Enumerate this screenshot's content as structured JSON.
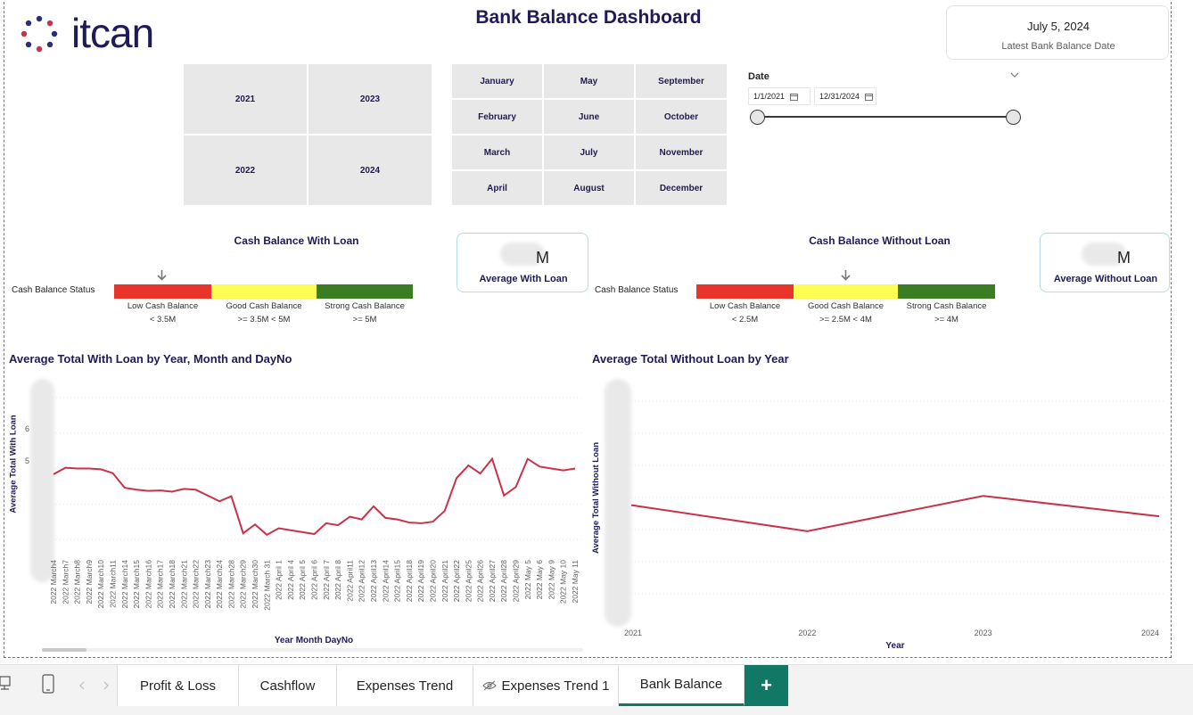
{
  "header": {
    "logo_text": "itcan",
    "title": "Bank Balance Dashboard",
    "latest_date_value": "July 5, 2024",
    "latest_date_label": "Latest Bank Balance Date"
  },
  "year_slicer": {
    "items": [
      "2021",
      "2023",
      "2022",
      "2024"
    ]
  },
  "month_slicer": {
    "items": [
      "January",
      "May",
      "September",
      "February",
      "June",
      "October",
      "March",
      "July",
      "November",
      "April",
      "August",
      "December"
    ]
  },
  "date_slicer": {
    "label": "Date",
    "start": "1/1/2021",
    "end": "12/31/2024",
    "calendar_icon": "calendar-icon",
    "chevron_icon": "chevron-down-icon"
  },
  "with_loan": {
    "title": "Cash Balance With Loan",
    "status_label": "Cash Balance Status",
    "segments": [
      {
        "name": "Low Cash Balance",
        "range": "< 3.5M",
        "color": "#e8342a"
      },
      {
        "name": "Good Cash Balance",
        "range": ">= 3.5M < 5M",
        "color": "#fdfd53"
      },
      {
        "name": "Strong Cash Balance",
        "range": ">= 5M",
        "color": "#3a7d22"
      }
    ],
    "kpi_value_suffix": "M",
    "kpi_label": "Average With Loan"
  },
  "without_loan": {
    "title": "Cash Balance Without Loan",
    "status_label": "Cash Balance Status",
    "segments": [
      {
        "name": "Low Cash Balance",
        "range": "< 2.5M",
        "color": "#e8342a"
      },
      {
        "name": "Good Cash Balance",
        "range": ">= 2.5M < 4M",
        "color": "#fdfd53"
      },
      {
        "name": "Strong Cash Balance",
        "range": ">= 4M",
        "color": "#3a7d22"
      }
    ],
    "kpi_value_suffix": "M",
    "kpi_label": "Average Without Loan"
  },
  "chart_data": [
    {
      "type": "line",
      "title": "Average Total With Loan by Year, Month and DayNo",
      "xlabel": "Year Month DayNo",
      "ylabel": "Average Total With Loan",
      "y_ticks": [
        "6",
        "5"
      ],
      "color": "#c8324b",
      "categories": [
        "2022 March4",
        "2022 March7",
        "2022 March8",
        "2022 March9",
        "2022 March10",
        "2022 March11",
        "2022 March14",
        "2022 March15",
        "2022 March16",
        "2022 March17",
        "2022 March18",
        "2022 March21",
        "2022 March22",
        "2022 March23",
        "2022 March24",
        "2022 March28",
        "2022 March29",
        "2022 March30",
        "2022 March 31",
        "2022 April 1",
        "2022 April 4",
        "2022 April 5",
        "2022 April 6",
        "2022 April 7",
        "2022 April 8",
        "2022 April11",
        "2022 April12",
        "2022 April13",
        "2022 April14",
        "2022 April15",
        "2022 April18",
        "2022 April19",
        "2022 April20",
        "2022 April21",
        "2022 April22",
        "2022 April25",
        "2022 April26",
        "2022 April27",
        "2022 April28",
        "2022 April29",
        "2022 May 5",
        "2022 May 6",
        "2022 May 9",
        "2022 May 10",
        "2022 May 11"
      ],
      "values": [
        4.75,
        4.92,
        4.9,
        4.9,
        4.88,
        4.78,
        4.4,
        4.35,
        4.32,
        4.33,
        4.3,
        4.37,
        4.35,
        4.2,
        4.05,
        4.18,
        3.22,
        3.45,
        3.18,
        3.35,
        3.3,
        3.25,
        3.2,
        3.48,
        3.43,
        3.65,
        3.58,
        3.92,
        3.62,
        3.58,
        3.5,
        3.48,
        3.52,
        3.8,
        4.65,
        4.98,
        4.77,
        5.15,
        4.2,
        4.42,
        5.15,
        4.95,
        4.9,
        4.85,
        4.9
      ],
      "ylim": [
        2.6,
        7.2
      ]
    },
    {
      "type": "line",
      "title": "Average Total Without Loan by Year",
      "xlabel": "Year",
      "ylabel": "Average Total Without Loan",
      "color": "#c8324b",
      "categories": [
        "2021",
        "2022",
        "2023",
        "2024"
      ],
      "values": [
        3.2,
        2.5,
        3.45,
        2.9
      ],
      "ylim": [
        0,
        6
      ]
    }
  ],
  "tabs": [
    {
      "label": "Profit & Loss",
      "active": false
    },
    {
      "label": "Cashflow",
      "active": false
    },
    {
      "label": "Expenses Trend",
      "active": false
    },
    {
      "label": "Expenses Trend 1",
      "active": false,
      "hidden": true
    },
    {
      "label": "Bank Balance",
      "active": true
    }
  ],
  "add_tab_label": "+",
  "accent_color": "#117865"
}
